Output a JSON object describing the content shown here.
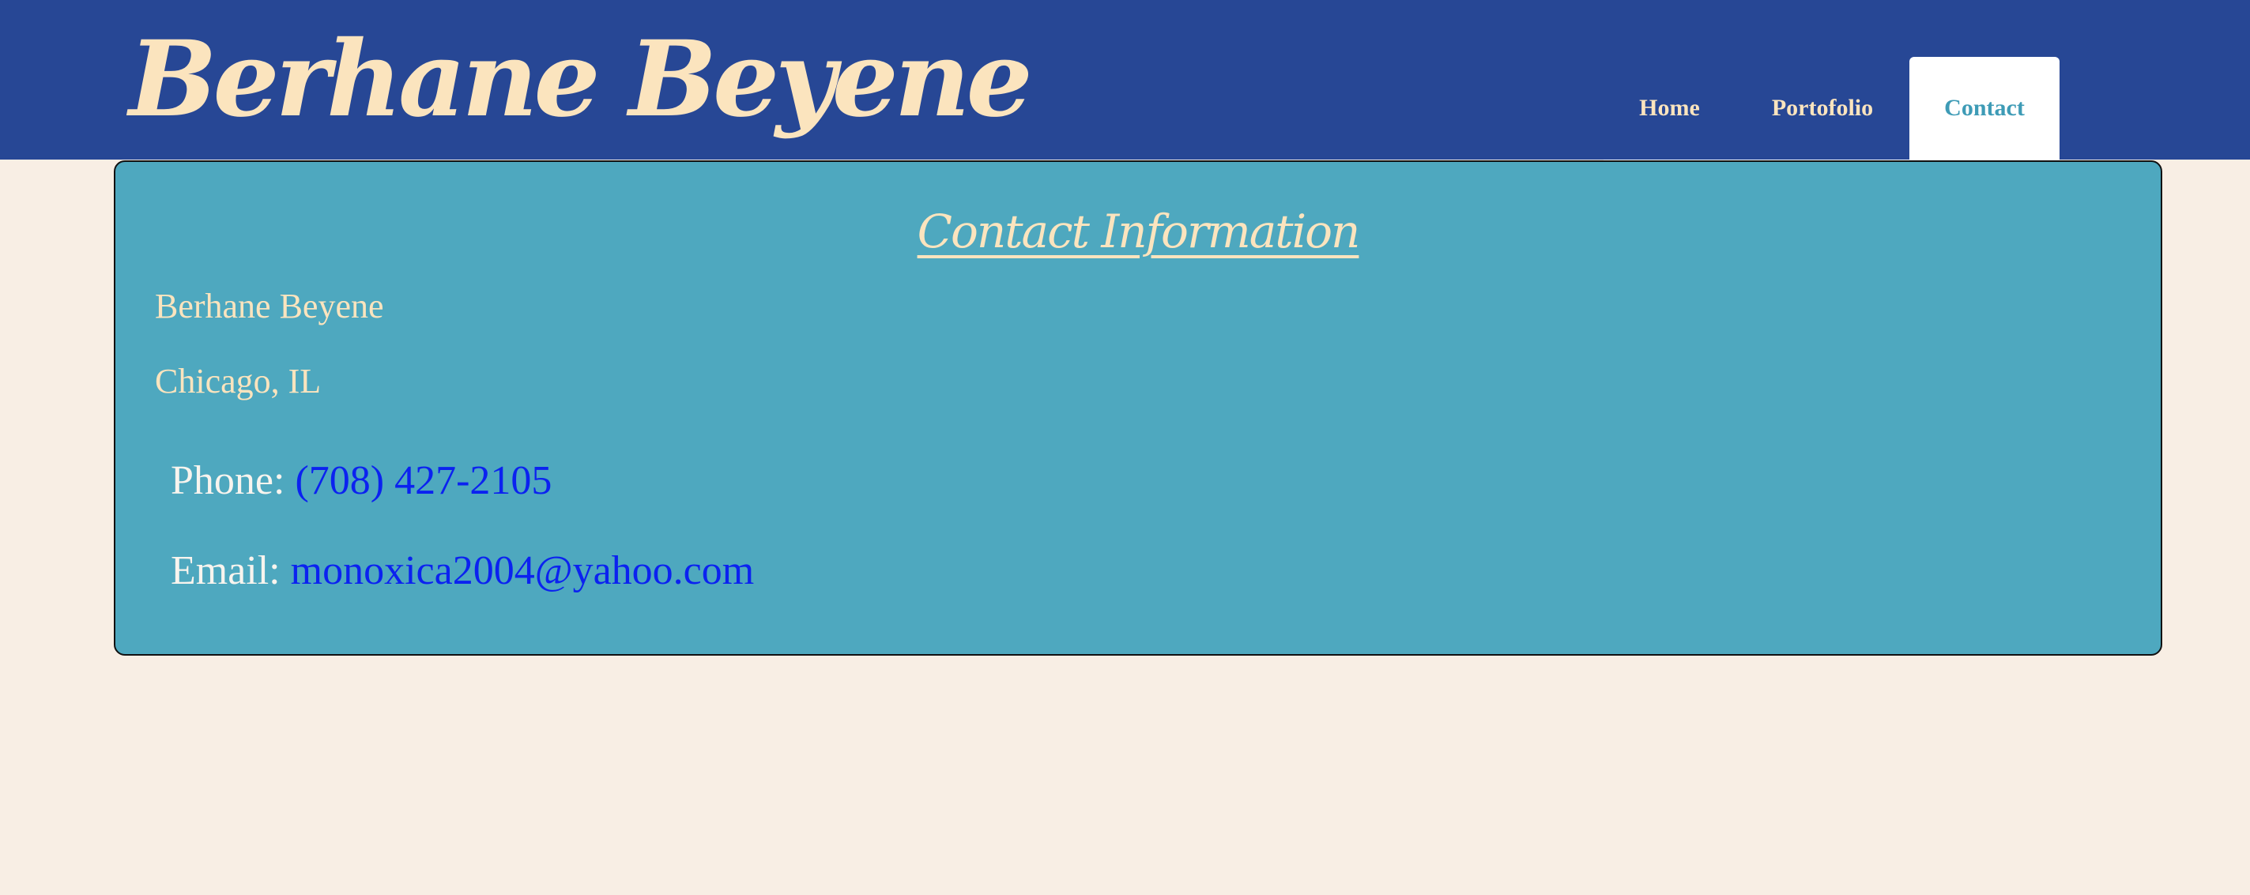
{
  "header": {
    "site_title": "Berhane Beyene",
    "nav": [
      {
        "label": "Home",
        "active": false
      },
      {
        "label": "Portofolio",
        "active": false
      },
      {
        "label": "Contact",
        "active": true
      }
    ]
  },
  "contact": {
    "heading": "Contact Information",
    "name": "Berhane Beyene",
    "location": "Chicago, IL",
    "phone_label": "Phone:",
    "phone_value": "(708) 427-2105",
    "email_label": "Email:",
    "email_value": "monoxica2004@yahoo.com"
  },
  "colors": {
    "header_background": "#274795",
    "page_background": "#f8eee4",
    "card_background": "#4ea8bf",
    "title_text": "#fbe4be",
    "link_text": "#0b22f0",
    "active_tab_text": "#3e9bb6"
  }
}
